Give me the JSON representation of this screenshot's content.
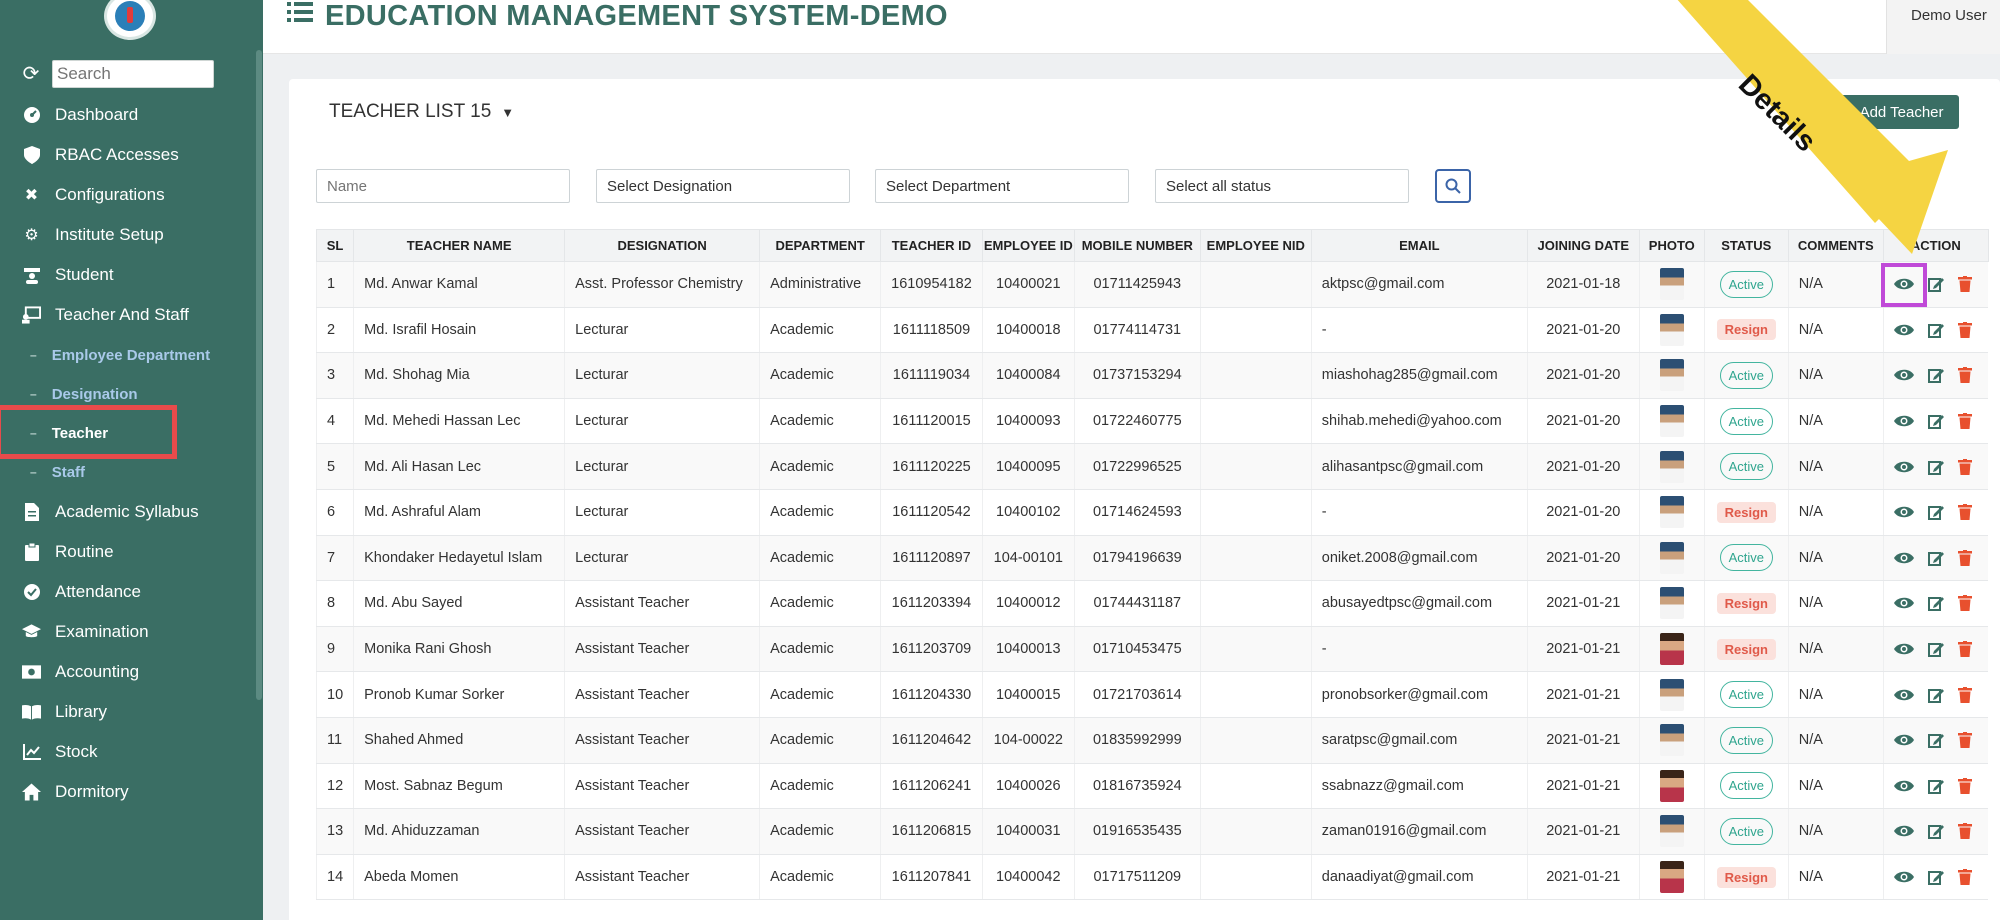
{
  "app": {
    "title": "EDUCATION MANAGEMENT SYSTEM-DEMO",
    "user": "Demo User"
  },
  "sidebar": {
    "search_placeholder": "Search",
    "items": [
      {
        "label": "Dashboard",
        "icon": "dashboard-icon"
      },
      {
        "label": "RBAC Accesses",
        "icon": "shield-icon"
      },
      {
        "label": "Configurations",
        "icon": "tools-icon"
      },
      {
        "label": "Institute Setup",
        "icon": "gear-icon"
      },
      {
        "label": "Student",
        "icon": "student-icon"
      },
      {
        "label": "Teacher And Staff",
        "icon": "teacher-icon"
      },
      {
        "label": "Academic Syllabus",
        "icon": "document-icon"
      },
      {
        "label": "Routine",
        "icon": "clipboard-icon"
      },
      {
        "label": "Attendance",
        "icon": "check-circle-icon"
      },
      {
        "label": "Examination",
        "icon": "graduation-cap-icon"
      },
      {
        "label": "Accounting",
        "icon": "money-icon"
      },
      {
        "label": "Library",
        "icon": "book-icon"
      },
      {
        "label": "Stock",
        "icon": "chart-line-icon"
      },
      {
        "label": "Dormitory",
        "icon": "home-icon"
      }
    ],
    "subitems": [
      {
        "label": "Employee Department"
      },
      {
        "label": "Designation"
      },
      {
        "label": "Teacher"
      },
      {
        "label": "Staff"
      }
    ]
  },
  "page": {
    "list_title": "TEACHER LIST 15",
    "add_button": "+ Add Teacher",
    "annotation_label": "Details",
    "filters": {
      "name_placeholder": "Name",
      "designation": "Select Designation",
      "department": "Select Department",
      "status": "Select all status"
    }
  },
  "table": {
    "headers": [
      "SL",
      "TEACHER NAME",
      "DESIGNATION",
      "DEPARTMENT",
      "TEACHER ID",
      "EMPLOYEE ID",
      "MOBILE NUMBER",
      "EMPLOYEE NID",
      "EMAIL",
      "JOINING DATE",
      "PHOTO",
      "STATUS",
      "COMMENTS",
      "ACTION"
    ],
    "rows": [
      {
        "sl": "1",
        "name": "Md. Anwar Kamal",
        "designation": "Asst. Professor Chemistry",
        "department": "Administrative",
        "teacher_id": "1610954182",
        "employee_id": "10400021",
        "mobile": "01711425943",
        "nid": "",
        "email": "aktpsc@gmail.com",
        "joining": "2021-01-18",
        "status": "Active",
        "comments": "N/A"
      },
      {
        "sl": "2",
        "name": "Md. Israfil Hosain",
        "designation": "Lecturar",
        "department": "Academic",
        "teacher_id": "1611118509",
        "employee_id": "10400018",
        "mobile": "01774114731",
        "nid": "",
        "email": "-",
        "joining": "2021-01-20",
        "status": "Resign",
        "comments": "N/A"
      },
      {
        "sl": "3",
        "name": "Md. Shohag Mia",
        "designation": "Lecturar",
        "department": "Academic",
        "teacher_id": "1611119034",
        "employee_id": "10400084",
        "mobile": "01737153294",
        "nid": "",
        "email": "miashohag285@gmail.com",
        "joining": "2021-01-20",
        "status": "Active",
        "comments": "N/A"
      },
      {
        "sl": "4",
        "name": "Md. Mehedi Hassan Lec",
        "designation": "Lecturar",
        "department": "Academic",
        "teacher_id": "1611120015",
        "employee_id": "10400093",
        "mobile": "01722460775",
        "nid": "",
        "email": "shihab.mehedi@yahoo.com",
        "joining": "2021-01-20",
        "status": "Active",
        "comments": "N/A"
      },
      {
        "sl": "5",
        "name": "Md. Ali Hasan Lec",
        "designation": "Lecturar",
        "department": "Academic",
        "teacher_id": "1611120225",
        "employee_id": "10400095",
        "mobile": "01722996525",
        "nid": "",
        "email": "alihasantpsc@gmail.com",
        "joining": "2021-01-20",
        "status": "Active",
        "comments": "N/A"
      },
      {
        "sl": "6",
        "name": "Md. Ashraful Alam",
        "designation": "Lecturar",
        "department": "Academic",
        "teacher_id": "1611120542",
        "employee_id": "10400102",
        "mobile": "01714624593",
        "nid": "",
        "email": "-",
        "joining": "2021-01-20",
        "status": "Resign",
        "comments": "N/A"
      },
      {
        "sl": "7",
        "name": "Khondaker Hedayetul Islam",
        "designation": "Lecturar",
        "department": "Academic",
        "teacher_id": "1611120897",
        "employee_id": "104-00101",
        "mobile": "01794196639",
        "nid": "",
        "email": "oniket.2008@gmail.com",
        "joining": "2021-01-20",
        "status": "Active",
        "comments": "N/A"
      },
      {
        "sl": "8",
        "name": "Md. Abu Sayed",
        "designation": "Assistant Teacher",
        "department": "Academic",
        "teacher_id": "1611203394",
        "employee_id": "10400012",
        "mobile": "01744431187",
        "nid": "",
        "email": "abusayedtpsc@gmail.com",
        "joining": "2021-01-21",
        "status": "Resign",
        "comments": "N/A"
      },
      {
        "sl": "9",
        "name": "Monika Rani Ghosh",
        "designation": "Assistant Teacher",
        "department": "Academic",
        "teacher_id": "1611203709",
        "employee_id": "10400013",
        "mobile": "01710453475",
        "nid": "",
        "email": "-",
        "joining": "2021-01-21",
        "status": "Resign",
        "comments": "N/A"
      },
      {
        "sl": "10",
        "name": "Pronob Kumar Sorker",
        "designation": "Assistant Teacher",
        "department": "Academic",
        "teacher_id": "1611204330",
        "employee_id": "10400015",
        "mobile": "01721703614",
        "nid": "",
        "email": "pronobsorker@gmail.com",
        "joining": "2021-01-21",
        "status": "Active",
        "comments": "N/A"
      },
      {
        "sl": "11",
        "name": "Shahed Ahmed",
        "designation": "Assistant Teacher",
        "department": "Academic",
        "teacher_id": "1611204642",
        "employee_id": "104-00022",
        "mobile": "01835992999",
        "nid": "",
        "email": "saratpsc@gmail.com",
        "joining": "2021-01-21",
        "status": "Active",
        "comments": "N/A"
      },
      {
        "sl": "12",
        "name": "Most. Sabnaz Begum",
        "designation": "Assistant Teacher",
        "department": "Academic",
        "teacher_id": "1611206241",
        "employee_id": "10400026",
        "mobile": "01816735924",
        "nid": "",
        "email": "ssabnazz@gmail.com",
        "joining": "2021-01-21",
        "status": "Active",
        "comments": "N/A"
      },
      {
        "sl": "13",
        "name": "Md. Ahiduzzaman",
        "designation": "Assistant Teacher",
        "department": "Academic",
        "teacher_id": "1611206815",
        "employee_id": "10400031",
        "mobile": "01916535435",
        "nid": "",
        "email": "zaman01916@gmail.com",
        "joining": "2021-01-21",
        "status": "Active",
        "comments": "N/A"
      },
      {
        "sl": "14",
        "name": "Abeda Momen",
        "designation": "Assistant Teacher",
        "department": "Academic",
        "teacher_id": "1611207841",
        "employee_id": "10400042",
        "mobile": "01717511209",
        "nid": "",
        "email": "danaadiyat@gmail.com",
        "joining": "2021-01-21",
        "status": "Resign",
        "comments": "N/A"
      }
    ]
  },
  "colors": {
    "brand": "#3a6e64",
    "active": "#2fa58e",
    "resign": "#e05a4a",
    "highlight_red": "#e84b4b",
    "highlight_purple": "#c04ad8",
    "arrow_yellow": "#f5d442"
  }
}
